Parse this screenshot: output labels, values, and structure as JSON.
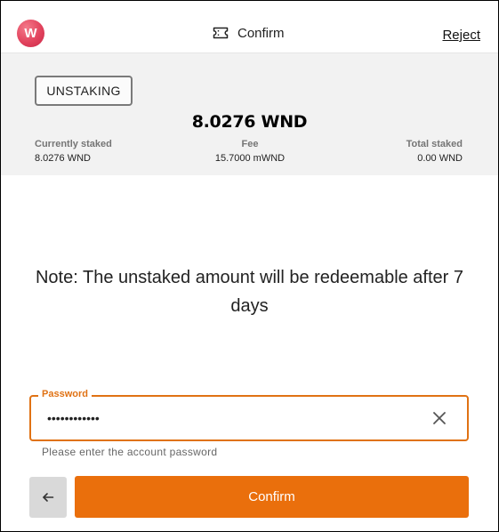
{
  "header": {
    "logo_letter": "W",
    "title": "Confirm",
    "reject_label": "Reject"
  },
  "summary": {
    "badge": "UNSTAKING",
    "amount": "8.0276  WND",
    "currently_staked_label": "Currently staked",
    "currently_staked_value": "8.0276 WND",
    "fee_label": "Fee",
    "fee_value": "15.7000 mWND",
    "total_staked_label": "Total staked",
    "total_staked_value": "0.00 WND"
  },
  "note": "Note: The unstaked amount will be redeemable after 7 days",
  "password": {
    "label": "Password",
    "value": "password1234",
    "helper": "Please enter the account password"
  },
  "actions": {
    "confirm_label": "Confirm"
  },
  "colors": {
    "accent": "#ea6f0c",
    "field_border": "#e07214",
    "summary_bg": "#f2f2f2",
    "back_bg": "#d9d9d9"
  }
}
